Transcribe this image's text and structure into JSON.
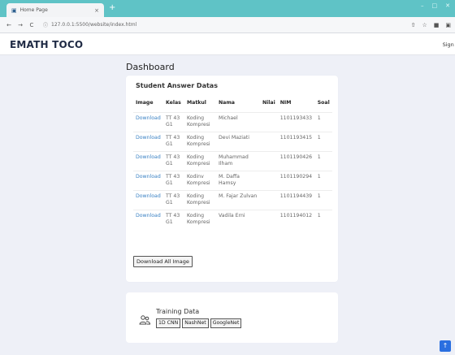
{
  "browser": {
    "tab_title": "Home Page",
    "tab_close": "×",
    "new_tab": "+",
    "url": "127.0.0.1:5500/website/index.html",
    "back": "←",
    "forward": "→",
    "reload": "C"
  },
  "header": {
    "brand": "EMATH TOCO",
    "signout": "Sign O"
  },
  "page": {
    "title": "Dashboard"
  },
  "answers": {
    "card_title": "Student Answer Datas",
    "columns": [
      "Image",
      "Kelas",
      "Matkul",
      "Nama",
      "Nilai",
      "NIM",
      "Soal"
    ],
    "rows": [
      {
        "image": "Download",
        "kelas": "TT 43 G1",
        "matkul": "Koding Kompresi",
        "nama": "Michael",
        "nilai": "",
        "nim": "1101193433",
        "soal": "1"
      },
      {
        "image": "Download",
        "kelas": "TT 43 G1",
        "matkul": "Koding Kompresi",
        "nama": "Devi Maziati",
        "nilai": "",
        "nim": "1101193415",
        "soal": "1"
      },
      {
        "image": "Download",
        "kelas": "TT 43 G1",
        "matkul": "Koding Kompresi",
        "nama": "Muhammad Ilham",
        "nilai": "",
        "nim": "1101190426",
        "soal": "1"
      },
      {
        "image": "Download",
        "kelas": "TT 43 G1",
        "matkul": "Kodinv Kompresi",
        "nama": "M. Daffa Hamsy",
        "nilai": "",
        "nim": "1101190294",
        "soal": "1"
      },
      {
        "image": "Download",
        "kelas": "TT 43 G1",
        "matkul": "Koding Kompresi",
        "nama": "M. Fajar Zulvan",
        "nilai": "",
        "nim": "1101194439",
        "soal": "1"
      },
      {
        "image": "Download",
        "kelas": "TT 43 G1",
        "matkul": "Koding Kompresi",
        "nama": "Vadila Erni",
        "nilai": "",
        "nim": "1101194012",
        "soal": "1"
      }
    ],
    "download_all": "Download All Image"
  },
  "training": {
    "title": "Training Data",
    "buttons": [
      "1D CNN",
      "NashNet",
      "GoogleNet"
    ]
  },
  "colors": {
    "tabbar": "#5fc3c6",
    "link": "#3b82c4",
    "scroll_top": "#2a6fe0"
  },
  "icons": {
    "scroll_top": "arrow-up-icon",
    "training": "users-icon"
  }
}
